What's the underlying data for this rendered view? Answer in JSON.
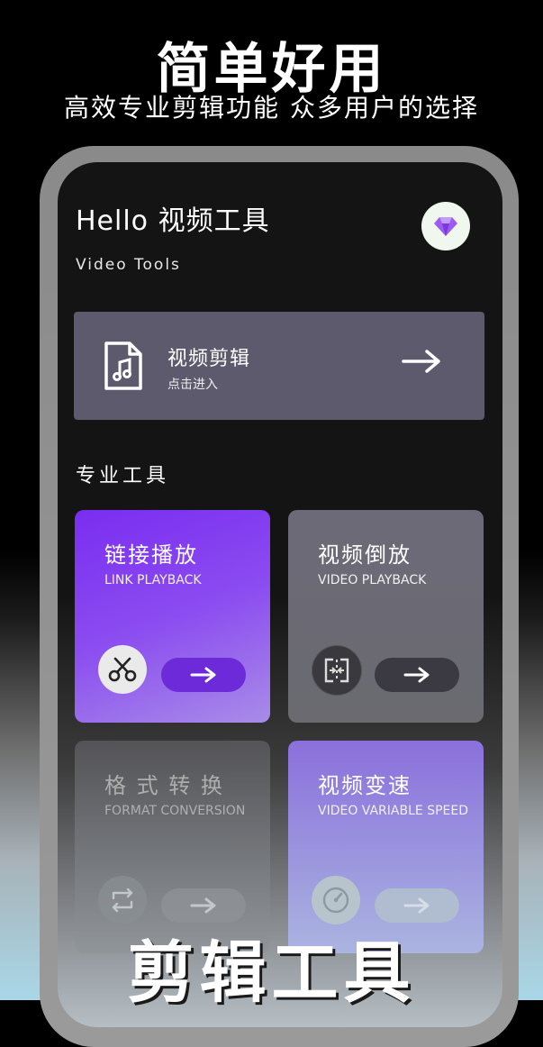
{
  "promo": {
    "title": "简单好用",
    "subtitle": "高效专业剪辑功能 众多用户的选择",
    "footer": "剪辑工具"
  },
  "header": {
    "greeting": "Hello 视频工具",
    "app_name": "Video Tools",
    "vip_icon": "diamond-icon"
  },
  "edit_card": {
    "title": "视频剪辑",
    "hint": "点击进入",
    "icon": "music-file-icon"
  },
  "section_title": "专业工具",
  "tools": [
    {
      "title": "链接播放",
      "subtitle": "LINK PLAYBACK",
      "icon": "scissors-icon"
    },
    {
      "title": "视频倒放",
      "subtitle": "VIDEO PLAYBACK",
      "icon": "reverse-icon"
    },
    {
      "title": "格 式 转 换",
      "subtitle": "FORMAT CONVERSION",
      "icon": "convert-icon"
    },
    {
      "title": "视频变速",
      "subtitle": "VIDEO VARIABLE SPEED",
      "icon": "speedometer-icon"
    }
  ],
  "colors": {
    "accent": "#7a2df0",
    "card": "#5c5a6c"
  }
}
